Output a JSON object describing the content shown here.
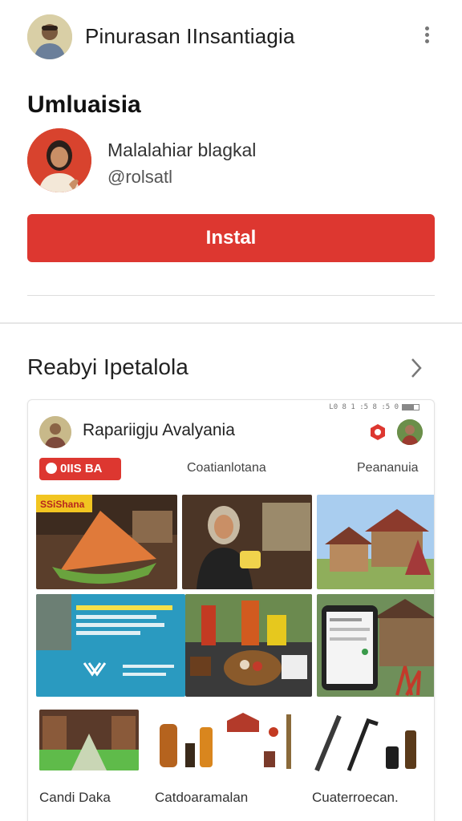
{
  "header": {
    "title": "Pinurasan IInsantiagia",
    "avatar_icon": "person-avatar-icon",
    "menu_icon": "kebab-menu-icon"
  },
  "app": {
    "section_title": "Umluaisia",
    "developer_name": "Malalahiar blagkal",
    "developer_handle": "@rolsatl",
    "install_label": "Instal",
    "accent_color": "#dd3730"
  },
  "recommendations": {
    "title": "Reabyi Ipetalola",
    "chevron_icon": "chevron-right-icon",
    "card": {
      "status_text": "L0 8 1 :5 8 :5 0",
      "title": "Rapariigju Avalyania",
      "badge_label": "0IIS BA",
      "tab_2": "Coatianlotana",
      "tab_3": "Peananuia",
      "tile_1_caption": "SSiShana",
      "bottom_labels": [
        "Candi Daka",
        "Catdoaramalan",
        "Cuaterroecan."
      ]
    }
  }
}
